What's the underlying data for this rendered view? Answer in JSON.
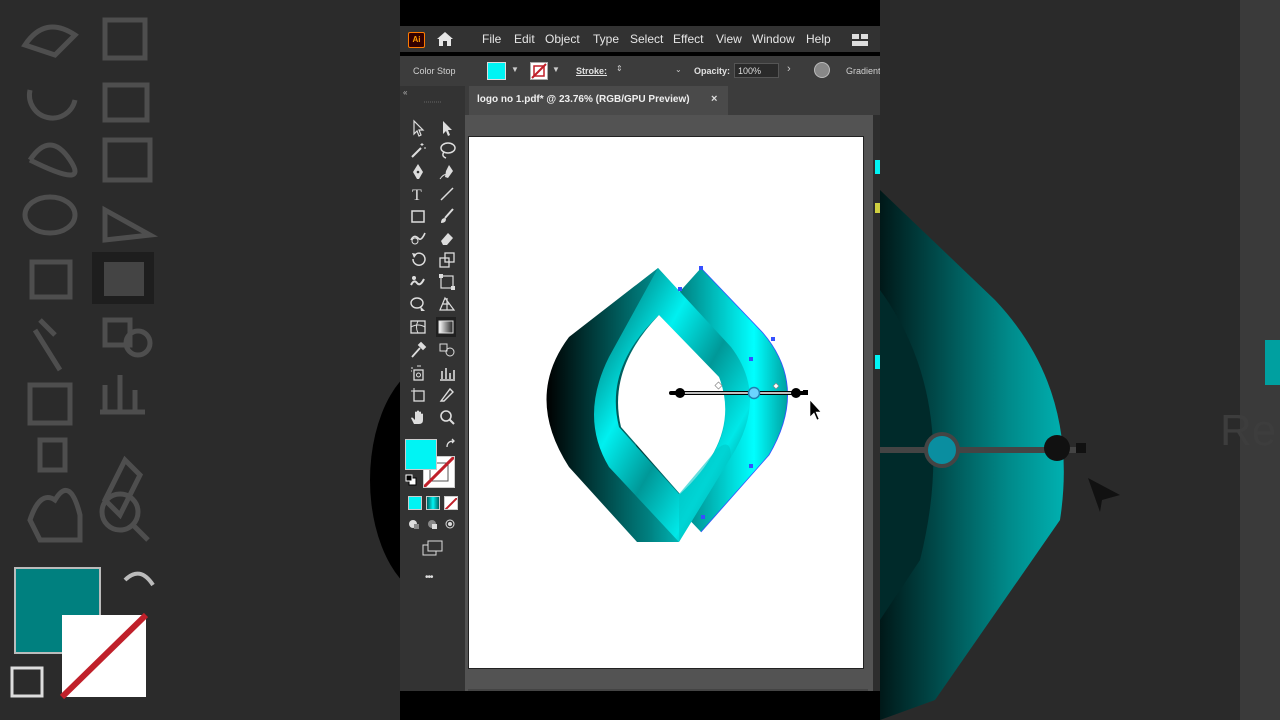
{
  "app": {
    "logo_text": "Ai",
    "home_icon": "home-icon"
  },
  "menu": {
    "items": [
      "File",
      "Edit",
      "Object",
      "Type",
      "Select",
      "Effect",
      "View",
      "Window",
      "Help"
    ]
  },
  "control_bar": {
    "context_label": "Color Stop",
    "fill_color": "#00f4f4",
    "stroke_label": "Stroke:",
    "opacity_label": "Opacity:",
    "opacity_value": "100%",
    "gradient_label": "Gradient"
  },
  "document": {
    "tab_title": "logo no 1.pdf* @ 23.76% (RGB/GPU Preview)",
    "close_icon": "×"
  },
  "tools": {
    "fill_color": "#00f4f4",
    "more_icon": "•••"
  },
  "background_zoom": {
    "partial_text": "Re"
  },
  "colors": {
    "accent": "#00f4f4",
    "teal_dark": "#007f80",
    "ui_dark": "#323232"
  }
}
